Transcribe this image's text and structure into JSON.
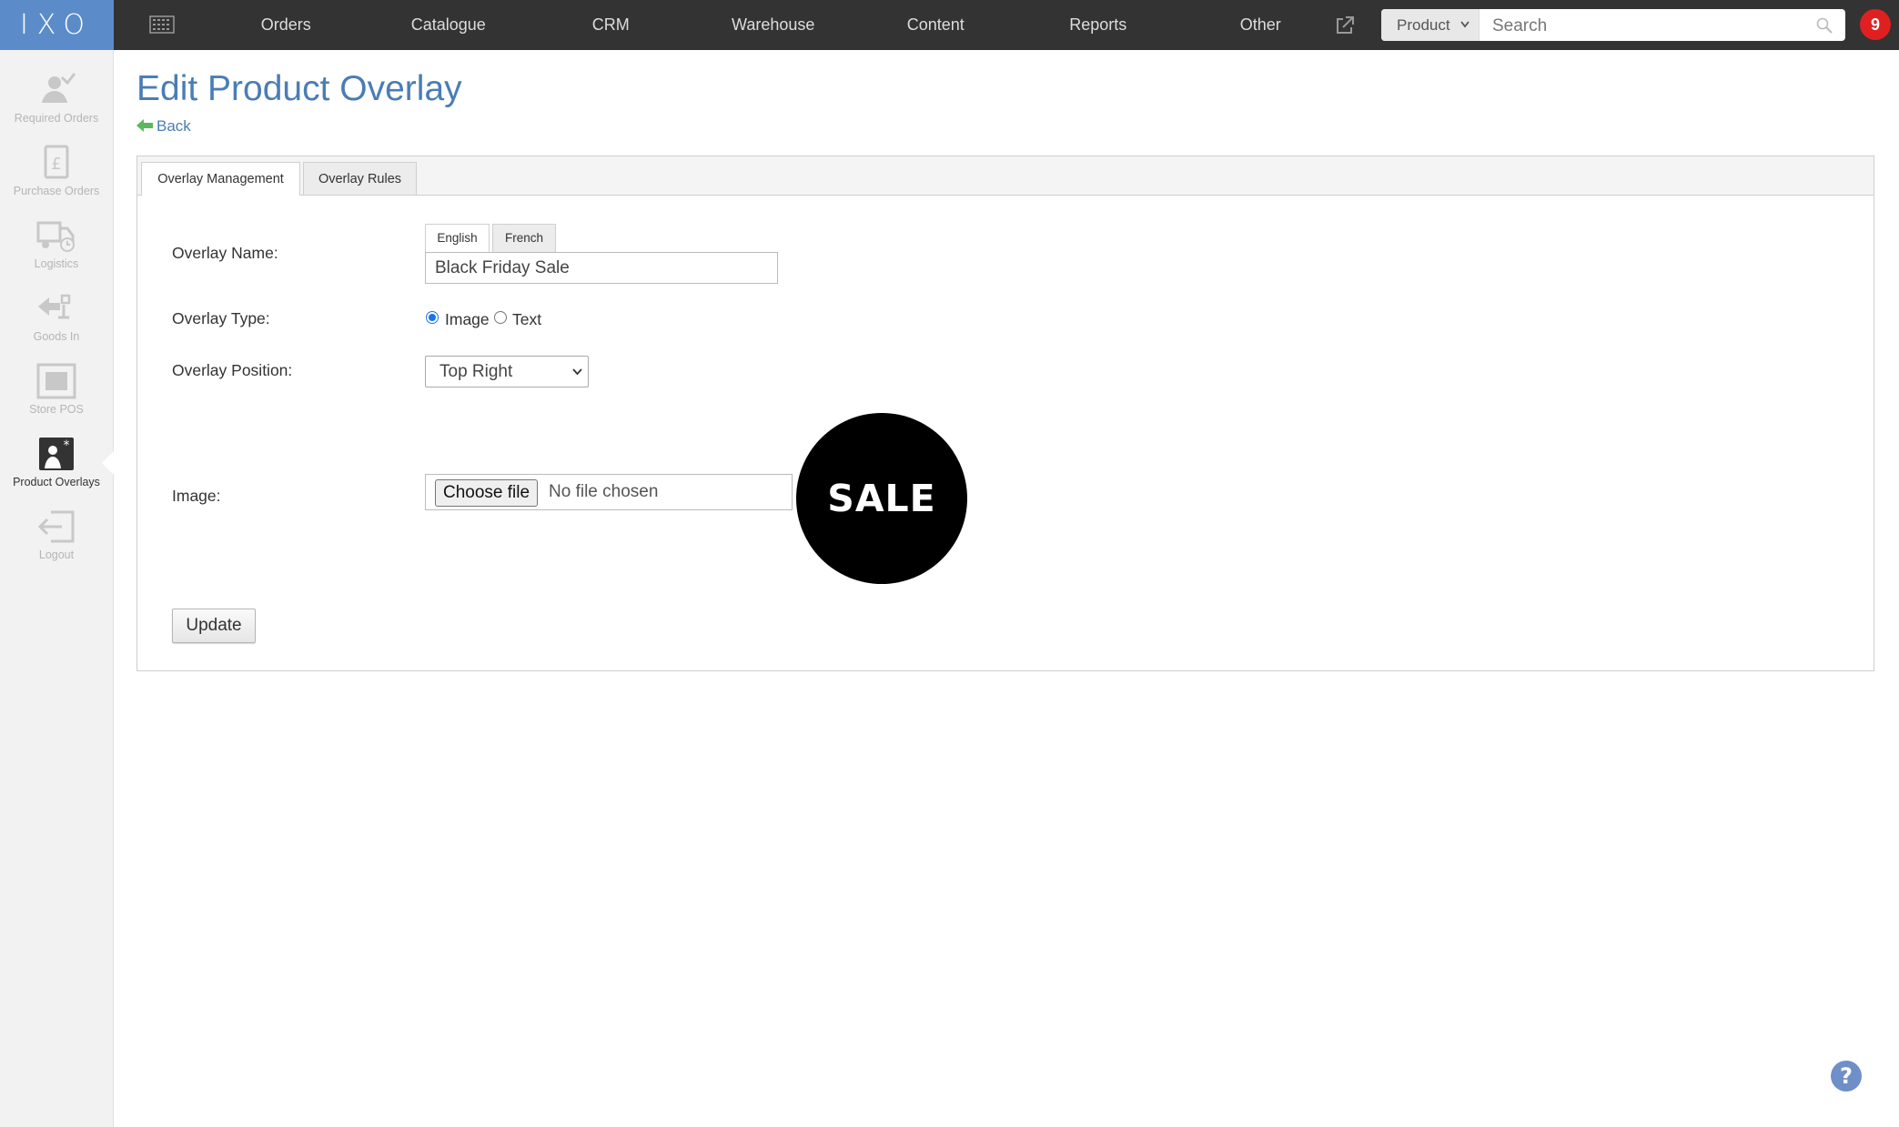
{
  "app": {
    "logo_text": "IXO"
  },
  "nav": {
    "items": [
      "Orders",
      "Catalogue",
      "CRM",
      "Warehouse",
      "Content",
      "Reports",
      "Other"
    ]
  },
  "search": {
    "scope": "Product",
    "placeholder": "Search"
  },
  "notifications": {
    "count": "9"
  },
  "sidebar": {
    "items": [
      {
        "label": "Required Orders",
        "icon": "required-orders-icon"
      },
      {
        "label": "Purchase Orders",
        "icon": "purchase-orders-icon"
      },
      {
        "label": "Logistics",
        "icon": "logistics-icon"
      },
      {
        "label": "Goods In",
        "icon": "goods-in-icon"
      },
      {
        "label": "Store POS",
        "icon": "store-pos-icon"
      },
      {
        "label": "Product Overlays",
        "icon": "product-overlays-icon",
        "active": true
      },
      {
        "label": "Logout",
        "icon": "logout-icon"
      }
    ]
  },
  "page": {
    "title": "Edit Product Overlay",
    "back_label": "Back"
  },
  "tabs": [
    "Overlay Management",
    "Overlay Rules"
  ],
  "form": {
    "name_label": "Overlay Name:",
    "languages": [
      "English",
      "French"
    ],
    "name_value": "Black Friday Sale",
    "type_label": "Overlay Type:",
    "type_options": [
      "Image",
      "Text"
    ],
    "type_selected": "Image",
    "position_label": "Overlay Position:",
    "position_value": "Top Right",
    "image_label": "Image:",
    "file_button": "Choose file",
    "file_status": "No file chosen",
    "image_text": "SALE",
    "update_label": "Update"
  },
  "colors": {
    "topbar": "#333333",
    "logo": "#5b8cc9",
    "title": "#4a7db5",
    "back_arrow": "#5cb85c",
    "badge": "#e02020",
    "help": "#6f8fc9"
  }
}
